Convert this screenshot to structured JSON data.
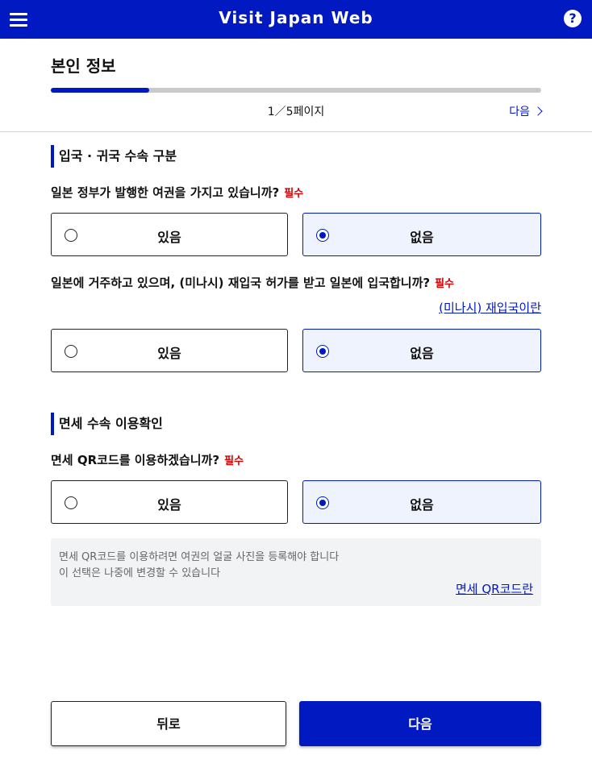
{
  "header": {
    "title": "Visit Japan Web",
    "menu_icon": "hamburger-menu-icon",
    "help_icon": "question-circle-icon",
    "help_glyph": "?"
  },
  "page": {
    "title": "본인 정보",
    "progress_fraction": 0.2,
    "page_indicator": "1／5페이지",
    "next_link": "다음"
  },
  "section1": {
    "title": "입국 · 귀국 수속 구분",
    "q1": {
      "text": "일본 정부가 발행한 여권을 가지고 있습니까?",
      "required": "필수",
      "options": [
        "있음",
        "없음"
      ],
      "selected": "없음"
    },
    "q2": {
      "text": "일본에 거주하고 있으며, (미나시) 재입국 허가를 받고 일본에 입국합니까?",
      "required": "필수",
      "link": "(미나시) 재입국이란",
      "options": [
        "있음",
        "없음"
      ],
      "selected": "없음"
    }
  },
  "section2": {
    "title": "면세 수속 이용확인",
    "q3": {
      "text": "면세 QR코드를 이용하겠습니까?",
      "required": "필수",
      "options": [
        "있음",
        "없음"
      ],
      "selected": "없음"
    },
    "note": {
      "line1": "면세 QR코드를 이용하려면 여권의 얼굴 사진을 등록해야 합니다",
      "line2": "이 선택은 나중에 변경할 수 있습니다",
      "link": "면세 QR코드란"
    }
  },
  "footer": {
    "back_label": "뒤로",
    "next_label": "다음"
  },
  "colors": {
    "brand": "#0019c1",
    "required": "#d60000",
    "selected_bg": "#eef3fd"
  }
}
